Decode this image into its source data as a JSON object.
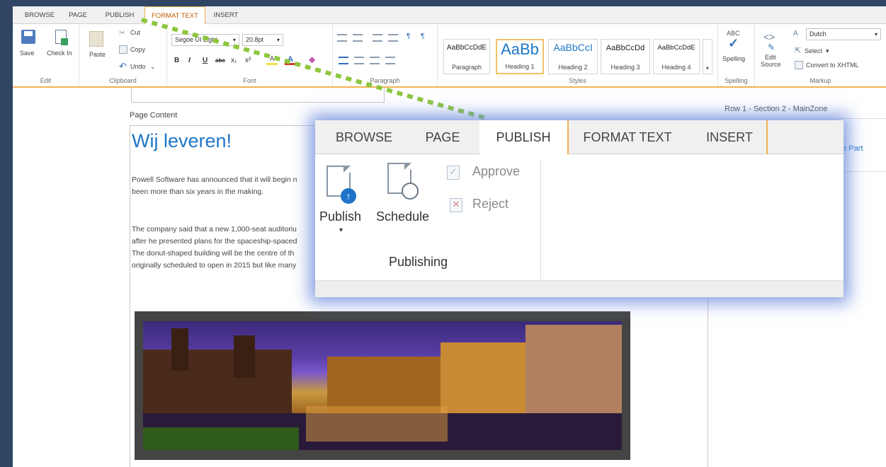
{
  "tabs": [
    "BROWSE",
    "PAGE",
    "PUBLISH",
    "FORMAT TEXT",
    "INSERT"
  ],
  "ribbon": {
    "edit": {
      "save": "Save",
      "check_in": "Check In",
      "group": "Edit"
    },
    "clipboard": {
      "paste": "Paste",
      "cut": "Cut",
      "copy": "Copy",
      "undo": "Undo",
      "group": "Clipboard"
    },
    "font": {
      "family": "Segoe UI Light",
      "size": "20.8pt",
      "bold": "B",
      "italic": "I",
      "underline": "U",
      "strike": "abc",
      "sub": "x₁",
      "sup": "x²",
      "group": "Font"
    },
    "paragraph": {
      "group": "Paragraph"
    },
    "styles": {
      "items": [
        {
          "sample": "AaBbCcDdE",
          "name": "Paragraph"
        },
        {
          "sample": "AaBb",
          "name": "Heading 1"
        },
        {
          "sample": "AaBbCcI",
          "name": "Heading 2"
        },
        {
          "sample": "AaBbCcDd",
          "name": "Heading 3"
        },
        {
          "sample": "AaBbCcDdE",
          "name": "Heading 4"
        }
      ],
      "group": "Styles"
    },
    "spelling": {
      "abc": "ABC",
      "label": "Spelling",
      "group": "Spelling"
    },
    "markup": {
      "lang": "Dutch",
      "select": "Select",
      "edit_source_1": "Edit",
      "edit_source_2": "Source",
      "convert": "Convert to XHTML",
      "group": "Markup"
    }
  },
  "content": {
    "label": "Page Content",
    "heading": "Wij leveren!",
    "p1": [
      "Powell Software has announced that it will begin n",
      "been more than six years in the making."
    ],
    "p2": [
      "The company said that a new 1,000-seat auditoriu",
      "after he presented plans for the spaceship-spaced",
      "The donut-shaped building will be the centre of th",
      "originally scheduled to open in 2015 but like many"
    ]
  },
  "right_panel": {
    "zone": "Row 1 - Section 2 - MainZone",
    "webpart": "eb Part"
  },
  "callout": {
    "tabs": [
      "BROWSE",
      "PAGE",
      "PUBLISH",
      "FORMAT TEXT",
      "INSERT"
    ],
    "publish": "Publish",
    "schedule": "Schedule",
    "approve": "Approve",
    "reject": "Reject",
    "group": "Publishing"
  },
  "colors": {
    "accent": "#f0b24f",
    "link": "#1e76c7",
    "background": "#2f4563",
    "dotted_line": "#8dc63f"
  }
}
